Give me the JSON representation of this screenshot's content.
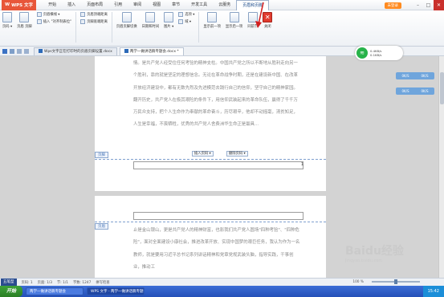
{
  "app": {
    "logo": "WPS 文字"
  },
  "menu": {
    "tabs": [
      "开始",
      "插入",
      "页面布局",
      "引用",
      "审阅",
      "视图",
      "章节",
      "开发工具",
      "云服务",
      "页眉和页脚"
    ],
    "active_tab": "页眉和页脚"
  },
  "title_right": {
    "login": "未登录",
    "minimize": "–",
    "restore": "□",
    "close": "✕"
  },
  "ribbon": {
    "big_buttons": [
      {
        "label": "页码 ▾",
        "icon": "page-number-icon"
      },
      {
        "label": "页眉 页脚",
        "icon": "header-footer-icon"
      },
      {
        "label": "页眉页脚切换",
        "icon": "switch-header-footer-icon"
      },
      {
        "label": "日期和时间",
        "icon": "date-time-icon"
      },
      {
        "label": "图片 ▾",
        "icon": "picture-icon"
      },
      {
        "label": "显示前一项",
        "icon": "show-previous-icon"
      },
      {
        "label": "显示后一项",
        "icon": "show-next-icon"
      },
      {
        "label": "同前节",
        "icon": "same-as-previous-icon"
      },
      {
        "label": "关闭",
        "icon": "close-header-footer-icon"
      }
    ],
    "small_buttons": [
      {
        "label": "页眉横线 ▾",
        "icon": "header-line-icon"
      },
      {
        "label": "插入 \"对齐制表位\"",
        "icon": "tab-stop-icon"
      },
      {
        "label": "页眉顶端距离",
        "icon": "header-distance-icon"
      },
      {
        "label": "页脚底端距离",
        "icon": "footer-distance-icon"
      },
      {
        "label": "选项 ▾",
        "icon": "options-icon"
      },
      {
        "label": "域 ▾",
        "icon": "field-icon"
      }
    ]
  },
  "doc_tabs": [
    {
      "label": "Wps文字正在打印时的页眉页脚设置.docx",
      "active": false
    },
    {
      "label": "两学一做讲话稿专题会.docx *",
      "active": true
    }
  ],
  "net_widget": {
    "up": "0.4KB/s",
    "down": "0.1KB/s"
  },
  "side_pills": [
    {
      "left": "0K/S",
      "right": "0K/S"
    },
    {
      "left": "0K/S",
      "right": "0K/S"
    }
  ],
  "page1": {
    "paragraph": "情。是共产党人经受住任何考验的精神支柱。中国共产党之所以不断地从胜利走向另一个胜利，靠的就是坚定的理想信念。无论在革命战争时期，还是在建设新中国、在改革开放经济建设中，都有无数先烈及先进模范去践行自己的信仰，坚守自己的精神家园。翻开历史，共产党人在极其艰险的条件下，用信仰武装起来的革命队伍，赢得了千千万万民众支持，把个人生命作为奉献的革命奋斗，历尽艰辛，他却不动摇毫，清贫知足，人生是幸福，不畏牺牲，优秀的共产党人舍费洲华生命正是最具...",
    "footer_tag": "页脚",
    "insert_page_btn": "插入页码 ▾",
    "delete_page_btn": "删除页码 ▾",
    "page_number": "1"
  },
  "page2": {
    "header_tag": "页眉",
    "paragraph": "止是金山银山，更是共产党人的精神财富，也影我们共产党人圆场\"四种考验\"、\"四种危险\"，面对全面建设小康社会，推进改革开放、实现中国梦的艰巨任务，我认为作为一名教师，就是要用习近平总书记系列讲话精神和党章党规武装头脑，指导实践，干事创业，推动工"
  },
  "status": {
    "ime": "五笔型",
    "page": "页码: 1",
    "pages": "页面: 1/3",
    "section": "节: 1/1",
    "words": "字数: 1247",
    "spell": "拼写检查",
    "zoom": "100 %"
  },
  "taskbar": {
    "start": "开始",
    "tasks": [
      "两学一做讲话稿专题会",
      "WPS 文字 - 两学一做讲话稿专题会.docx"
    ],
    "clock": "15:42"
  },
  "watermark": {
    "text": "Baidu经验",
    "sub": "jingyan.baidu.com"
  },
  "colors": {
    "accent": "#2c6ab8",
    "close": "#e13b2e",
    "taskbar": "#2450b8"
  }
}
